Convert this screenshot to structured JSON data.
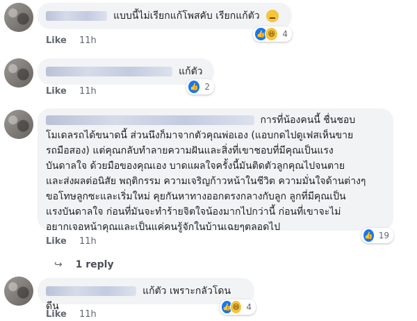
{
  "comments": [
    {
      "text": "แบบนี้ไม่เรียกแก้โพสคับ เรียกแก้ตัว",
      "like_label": "Like",
      "time": "11h",
      "reaction_count": "4",
      "reactions": [
        "like-icon",
        "haha-icon"
      ]
    },
    {
      "text": "แก้ตัว",
      "like_label": "Like",
      "time": "11h",
      "reaction_count": "2",
      "reactions": [
        "like-icon"
      ]
    },
    {
      "text_lines": [
        "การที่น้องคนนี้ ชื่นชอบ",
        "โมเดลรถได้ขนาดนี้ ส่วนนึงก็มาจากตัวคุณพ่อเอง (แอบกดไปดูเฟสเห็นขาย",
        "รถมือสอง) แต่คุณกลับทำลายความฝันและสิ่งที่เขาชอบที่มีคุณเป็นแรง",
        "บันดาลใจ ด้วยมือของคุณเอง บาดแผลใจครั้งนี้มันติดตัวลูกคุณไปจนตาย",
        "และส่งผลต่อนิสัย พฤติกรรม ความเจริญก้าวหน้าในชีวิต ความมั่นใจด้านต่างๆ",
        "ขอโทษลูกซะและเริ่มใหม่ คุยกันหาทางออกตรงกลางกับลูก ลูกที่มีคุณเป็น",
        "แรงบันดาลใจ ก่อนที่มันจะทำร้ายจิตใจน้องมากไปกว่านี้ ก่อนที่เขาจะไม่",
        "อยากเจอหน้าคุณและเป็นแค่คนรู้จักในบ้านเฉยๆตลอดไป"
      ],
      "like_label": "Like",
      "time": "11h",
      "reaction_count": "19",
      "reactions": [
        "like-icon"
      ],
      "reply_label": "1 reply"
    },
    {
      "text": "แก้ตัว เพราะกลัวโดน ดีน",
      "like_label": "Like",
      "time": "11h",
      "reaction_count": "4",
      "reactions": [
        "like-icon",
        "haha-icon"
      ]
    }
  ],
  "colors": {
    "bubble": "#f2f3f5",
    "like_blue": "#1877f2",
    "haha_yellow": "#f7c43a",
    "meta": "#606770"
  }
}
